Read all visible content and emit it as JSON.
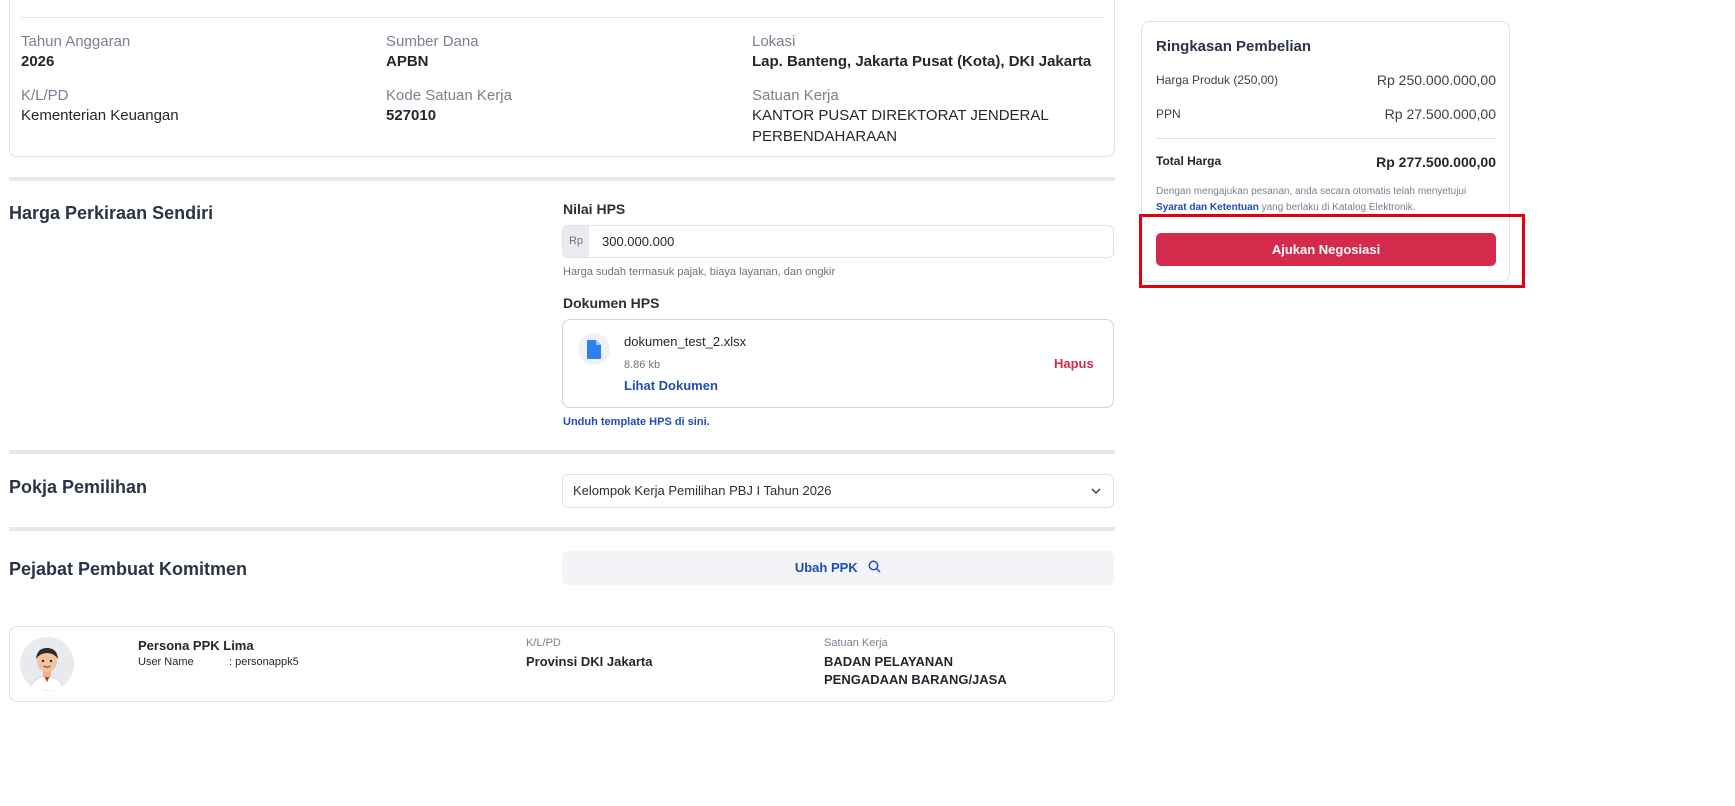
{
  "info": {
    "tahun_anggaran_label": "Tahun Anggaran",
    "tahun_anggaran_value": "2026",
    "sumber_dana_label": "Sumber Dana",
    "sumber_dana_value": "APBN",
    "lokasi_label": "Lokasi",
    "lokasi_value": "Lap. Banteng, Jakarta Pusat (Kota), DKI Jakarta",
    "klpd_label": "K/L/PD",
    "klpd_value": "Kementerian Keuangan",
    "kode_satker_label": "Kode Satuan Kerja",
    "kode_satker_value": "527010",
    "satker_label": "Satuan Kerja",
    "satker_value_line1": "KANTOR PUSAT DIREKTORAT JENDERAL",
    "satker_value_line2": "PERBENDAHARAAN"
  },
  "hps": {
    "section_title": "Harga Perkiraan Sendiri",
    "nilai_label": "Nilai HPS",
    "currency_prefix": "Rp",
    "nilai_value": "300.000.000",
    "hint": "Harga sudah termasuk pajak, biaya layanan, dan ongkir",
    "dokumen_label": "Dokumen HPS",
    "file_name": "dokumen_test_2.xlsx",
    "file_size": "8.86 kb",
    "view_link": "Lihat Dokumen",
    "delete_label": "Hapus",
    "template_link": "Unduh template HPS di sini."
  },
  "pokja": {
    "section_title": "Pokja Pemilihan",
    "selected": "Kelompok Kerja Pemilihan PBJ I Tahun 2026"
  },
  "ppk": {
    "section_title": "Pejabat Pembuat Komitmen",
    "change_button": "Ubah PPK",
    "name": "Persona PPK Lima",
    "username_label": "User Name",
    "username_value": ": personappk5",
    "klpd_label": "K/L/PD",
    "klpd_value": "Provinsi DKI Jakarta",
    "satker_label": "Satuan Kerja",
    "satker_line1": "BADAN PELAYANAN",
    "satker_line2": "PENGADAAN BARANG/JASA"
  },
  "summary": {
    "title": "Ringkasan Pembelian",
    "harga_produk_label": "Harga Produk (250,00)",
    "harga_produk_value": "Rp 250.000.000,00",
    "ppn_label": "PPN",
    "ppn_value": "Rp 27.500.000,00",
    "total_label": "Total Harga",
    "total_value": "Rp 277.500.000,00",
    "terms_prefix": "Dengan mengajukan pesanan, anda secara otomatis telah menyetujui",
    "terms_link": "Syarat dan Ketentuan",
    "terms_suffix": " yang berlaku di Katalog Elektronik.",
    "submit_button": "Ajukan Negosiasi"
  },
  "colors": {
    "accent_red": "#d42a4c",
    "link_blue": "#1f4db5",
    "highlight_border": "#e0000f"
  }
}
